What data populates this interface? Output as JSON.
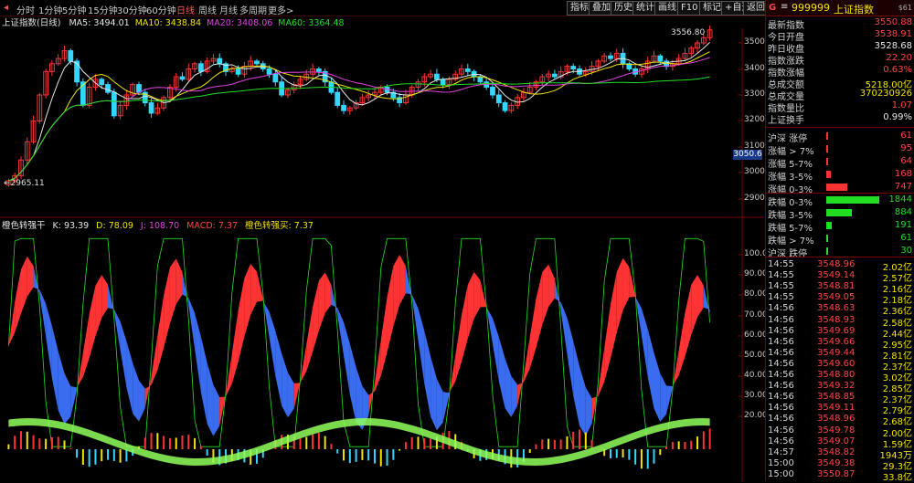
{
  "header": {
    "title": "上证指数(日线)",
    "menu": [
      "指标",
      "叠加",
      "历史",
      "统计",
      "画线",
      "F10",
      "标记",
      "+自选",
      "返回"
    ]
  },
  "periods": [
    "分时",
    "1分钟",
    "5分钟",
    "15分钟",
    "30分钟",
    "60分钟",
    "日线",
    "周线",
    "月线",
    "多周期",
    "更多>"
  ],
  "active_period": "日线",
  "ma_legend": [
    {
      "label": "MA5: 3494.01",
      "color": "#e6e6e6"
    },
    {
      "label": "MA10: 3438.84",
      "color": "#f2e300"
    },
    {
      "label": "MA20: 3408.06",
      "color": "#e040e0"
    },
    {
      "label": "MA60: 3364.48",
      "color": "#22dd22"
    }
  ],
  "price_axis": [
    "3500",
    "3400",
    "3300",
    "3200",
    "3100",
    "3000",
    "2900"
  ],
  "axis_marker": "3050.6",
  "high_label": "3556.80",
  "low_label": "2965.11",
  "indicator_legend": [
    {
      "label": "橙色转强干",
      "color": "#e6e6e6"
    },
    {
      "label": "K: 93.39",
      "color": "#e6e6e6"
    },
    {
      "label": "D: 78.09",
      "color": "#f2e300"
    },
    {
      "label": "J: 108.70",
      "color": "#e040e0"
    },
    {
      "label": "MACD: 7.37",
      "color": "#ff4444"
    },
    {
      "label": "橙色转强买: 7.37",
      "color": "#f2e300"
    }
  ],
  "kdj_axis": [
    "100.0",
    "90.00",
    "80.00",
    "70.00",
    "60.00",
    "50.00",
    "40.00",
    "30.00",
    "20.00"
  ],
  "stock": {
    "icon": "G",
    "code": "999999",
    "name": "上证指数",
    "badge": "$61"
  },
  "quote": [
    {
      "label": "最新指数",
      "value": "3550.88",
      "color": "red"
    },
    {
      "label": "今日开盘",
      "value": "3538.91",
      "color": "red"
    },
    {
      "label": "昨日收盘",
      "value": "3528.68",
      "color": "white"
    },
    {
      "label": "指数涨跌",
      "value": "22.20",
      "color": "red"
    },
    {
      "label": "指数涨幅",
      "value": "0.63%",
      "color": "red"
    },
    {
      "label": "总成交额",
      "value": "5218.00亿",
      "color": "yellow"
    },
    {
      "label": "总成交量",
      "value": "370230926",
      "color": "yellow"
    },
    {
      "label": "指数量比",
      "value": "1.07",
      "color": "red"
    },
    {
      "label": "上证换手",
      "value": "0.99%",
      "color": "white"
    }
  ],
  "breadth_up": [
    {
      "label": "沪深 涨停",
      "value": "61",
      "bar": 0.02
    },
    {
      "label": "涨幅 > 7%",
      "value": "95",
      "bar": 0.04
    },
    {
      "label": "涨幅 5-7%",
      "value": "64",
      "bar": 0.03
    },
    {
      "label": "涨幅 3-5%",
      "value": "168",
      "bar": 0.09
    },
    {
      "label": "涨幅 0-3%",
      "value": "747",
      "bar": 0.4
    }
  ],
  "breadth_down": [
    {
      "label": "跌幅 0-3%",
      "value": "1844",
      "bar": 1.0
    },
    {
      "label": "跌幅 3-5%",
      "value": "884",
      "bar": 0.48
    },
    {
      "label": "跌幅 5-7%",
      "value": "191",
      "bar": 0.1
    },
    {
      "label": "跌幅 > 7%",
      "value": "61",
      "bar": 0.03
    },
    {
      "label": "沪深 跌停",
      "value": "30",
      "bar": 0.01
    }
  ],
  "ticks": [
    {
      "time": "14:55",
      "price": "3548.96",
      "vol": "2.02亿"
    },
    {
      "time": "14:55",
      "price": "3549.14",
      "vol": "2.57亿"
    },
    {
      "time": "14:55",
      "price": "3548.81",
      "vol": "2.16亿"
    },
    {
      "time": "14:55",
      "price": "3549.05",
      "vol": "2.18亿"
    },
    {
      "time": "14:56",
      "price": "3548.63",
      "vol": "2.36亿"
    },
    {
      "time": "14:56",
      "price": "3548.93",
      "vol": "2.58亿"
    },
    {
      "time": "14:56",
      "price": "3549.69",
      "vol": "2.44亿"
    },
    {
      "time": "14:56",
      "price": "3549.66",
      "vol": "2.95亿"
    },
    {
      "time": "14:56",
      "price": "3549.44",
      "vol": "2.81亿"
    },
    {
      "time": "14:56",
      "price": "3549.60",
      "vol": "2.37亿"
    },
    {
      "time": "14:56",
      "price": "3548.80",
      "vol": "3.02亿"
    },
    {
      "time": "14:56",
      "price": "3549.32",
      "vol": "2.85亿"
    },
    {
      "time": "14:56",
      "price": "3548.85",
      "vol": "2.37亿"
    },
    {
      "time": "14:56",
      "price": "3549.11",
      "vol": "2.79亿"
    },
    {
      "time": "14:56",
      "price": "3548.96",
      "vol": "2.68亿"
    },
    {
      "time": "14:56",
      "price": "3549.78",
      "vol": "2.00亿"
    },
    {
      "time": "14:56",
      "price": "3549.07",
      "vol": "1.59亿"
    },
    {
      "time": "14:57",
      "price": "3548.82",
      "vol": "1943万"
    },
    {
      "time": "15:00",
      "price": "3549.38",
      "vol": "29.3亿"
    },
    {
      "time": "15:00",
      "price": "3550.87",
      "vol": "33.8亿"
    }
  ]
}
